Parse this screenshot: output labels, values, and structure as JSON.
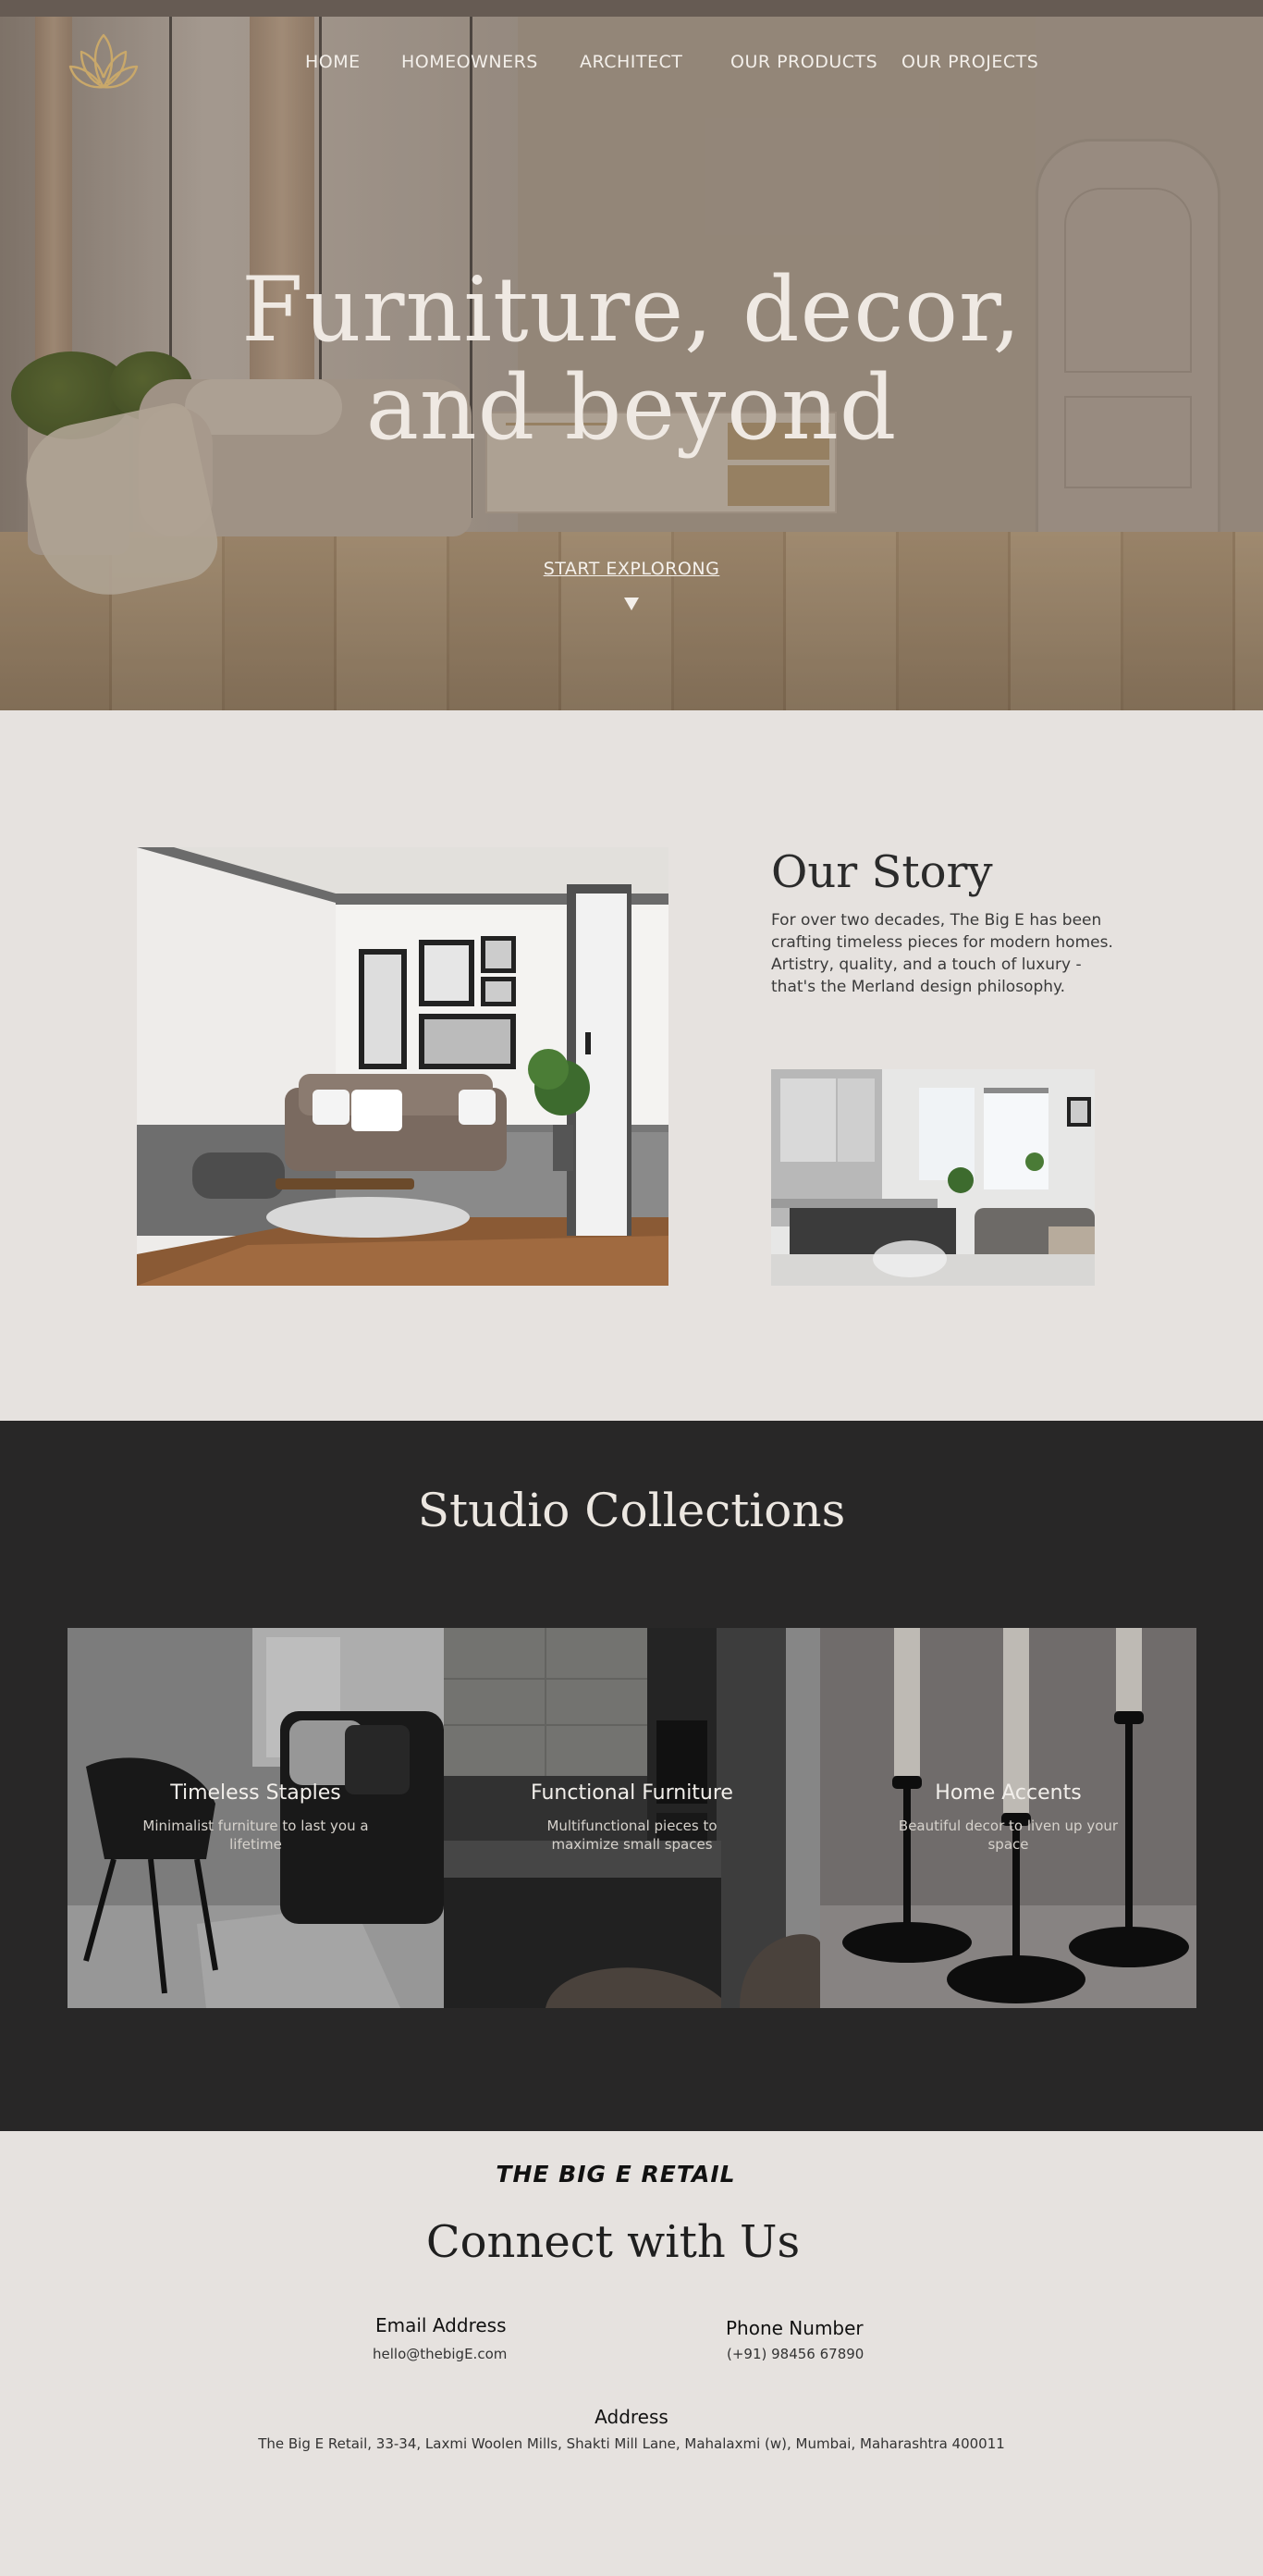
{
  "nav": {
    "logo_icon": "lotus-logo-icon",
    "items": [
      {
        "label": "HOME"
      },
      {
        "label": "HOMEOWNERS"
      },
      {
        "label": "ARCHITECT"
      },
      {
        "label": "OUR PRODUCTS"
      },
      {
        "label": "OUR PROJECTS"
      }
    ]
  },
  "hero": {
    "title_line1": "Furniture, decor,",
    "title_line2": "and beyond",
    "cta_label": "START EXPLORONG",
    "cta_icon": "arrow-down-icon"
  },
  "story": {
    "title": "Our Story",
    "text": "For over two decades, The Big E has been crafting timeless pieces for modern homes. Artistry, quality, and a touch of luxury - that's the Merland design philosophy."
  },
  "collections": {
    "title": "Studio Collections",
    "items": [
      {
        "title": "Timeless Staples",
        "description": "Minimalist furniture to last you a lifetime"
      },
      {
        "title": "Functional Furniture",
        "description": "Multifunctional pieces to maximize small spaces"
      },
      {
        "title": "Home Accents",
        "description": "Beautiful decor to liven up your space"
      }
    ]
  },
  "contact": {
    "brand": "THE BIG E RETAIL",
    "title": "Connect with Us",
    "email_label": "Email Address",
    "email_value": "hello@thebigE.com",
    "phone_label": "Phone Number",
    "phone_value": "(+91) 98456 67890",
    "address_label": "Address",
    "address_value": "The Big E Retail, 33-34, Laxmi Woolen Mills, Shakti Mill Lane, Mahalaxmi (w), Mumbai, Maharashtra 400011"
  },
  "colors": {
    "page_bg": "#e6e2df",
    "dark_section": "#282727",
    "logo_gold": "#c9a86a"
  }
}
